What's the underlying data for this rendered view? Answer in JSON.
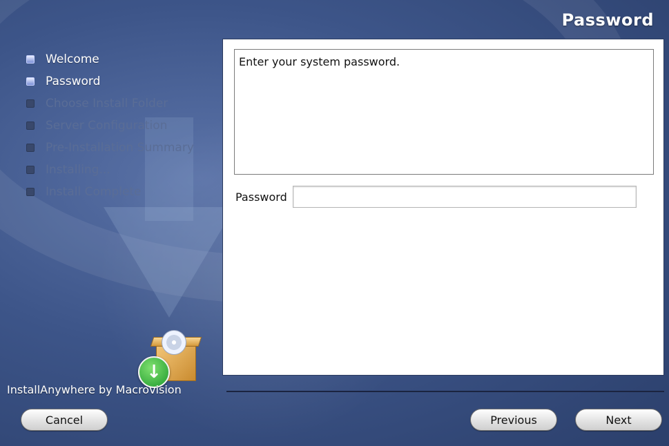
{
  "header": {
    "title": "Password"
  },
  "steps": [
    {
      "label": "Welcome",
      "state": "done"
    },
    {
      "label": "Password",
      "state": "done"
    },
    {
      "label": "Choose Install Folder",
      "state": "pending"
    },
    {
      "label": "Server Configuration",
      "state": "pending"
    },
    {
      "label": "Pre-Installation Summary",
      "state": "pending"
    },
    {
      "label": "Installing...",
      "state": "pending"
    },
    {
      "label": "Install Complete",
      "state": "pending"
    }
  ],
  "main": {
    "message": "Enter your system password.",
    "password_label": "Password",
    "password_value": ""
  },
  "footer": {
    "brand": "InstallAnywhere by Macrovision",
    "cancel_label": "Cancel",
    "previous_label": "Previous",
    "next_label": "Next"
  },
  "icons": {
    "logo": "installanywhere-box-icon",
    "badge": "download-arrow-icon"
  },
  "colors": {
    "background": "#3d5589",
    "active_step": "#ffffff",
    "inactive_step": "#5a6d96",
    "badge": "#1e9a2d"
  }
}
